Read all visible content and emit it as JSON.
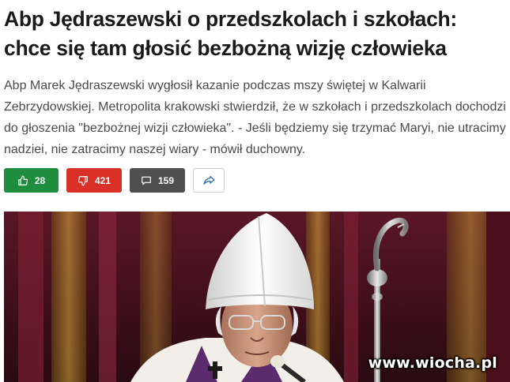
{
  "article": {
    "title": "Abp Jędraszewski o przedszkolach i szkołach: chce się tam głosić bezbożną wizję człowieka",
    "lead": "Abp Marek Jędraszewski wygłosił kazanie podczas mszy świętej w Kalwarii Zebrzydowskiej. Metropolita krakowski stwierdził, że w szkołach i przedszkolach dochodzi do głoszenia \"bezbożnej wizji człowieka\". - Jeśli będziemy się trzymać Maryi, nie utracimy nadziei, nie zatracimy naszej wiary - mówił duchowny."
  },
  "actions": {
    "likes": "28",
    "dislikes": "421",
    "comments": "159",
    "like_icon": "thumbs-up-icon",
    "dislike_icon": "thumbs-down-icon",
    "comment_icon": "comment-icon",
    "share_icon": "share-arrow-icon"
  },
  "colors": {
    "like": "#1e8e3e",
    "dislike": "#d93028",
    "comments": "#4f4f4f",
    "share_icon": "#2a6fb0"
  },
  "image": {
    "watermark": "www.wiocha.pl"
  }
}
